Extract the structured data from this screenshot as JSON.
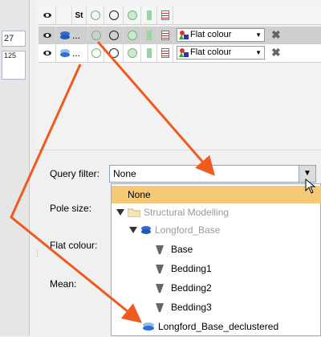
{
  "left_strip": {
    "cells": [
      "27",
      "125"
    ]
  },
  "grid": {
    "header": {
      "st_label": "St"
    },
    "rows": [
      {
        "name_prefix": "...",
        "dropdown": "Flat colour"
      },
      {
        "name_prefix": "...",
        "dropdown": "Flat colour"
      }
    ]
  },
  "form": {
    "query_filter_label": "Query filter:",
    "query_filter_value": "None",
    "pole_size_label": "Pole size:",
    "flat_colour_label": "Flat colour:",
    "mean_label": "Mean:"
  },
  "popup": {
    "items": [
      {
        "label": "None"
      },
      {
        "label": "Structural Modelling"
      },
      {
        "label": "Longford_Base"
      },
      {
        "label": "Base"
      },
      {
        "label": "Bedding1"
      },
      {
        "label": "Bedding2"
      },
      {
        "label": "Bedding3"
      },
      {
        "label": "Longford_Base_declustered"
      }
    ]
  },
  "colors": {
    "arrow": "#f05a1e",
    "highlight": "#f6c977"
  },
  "icons": [
    "eye-icon",
    "circle-icon",
    "dots-circle-icon",
    "list-icon",
    "folder-icon",
    "mesh-icon",
    "plane-icon",
    "close-icon",
    "cursor-icon"
  ]
}
